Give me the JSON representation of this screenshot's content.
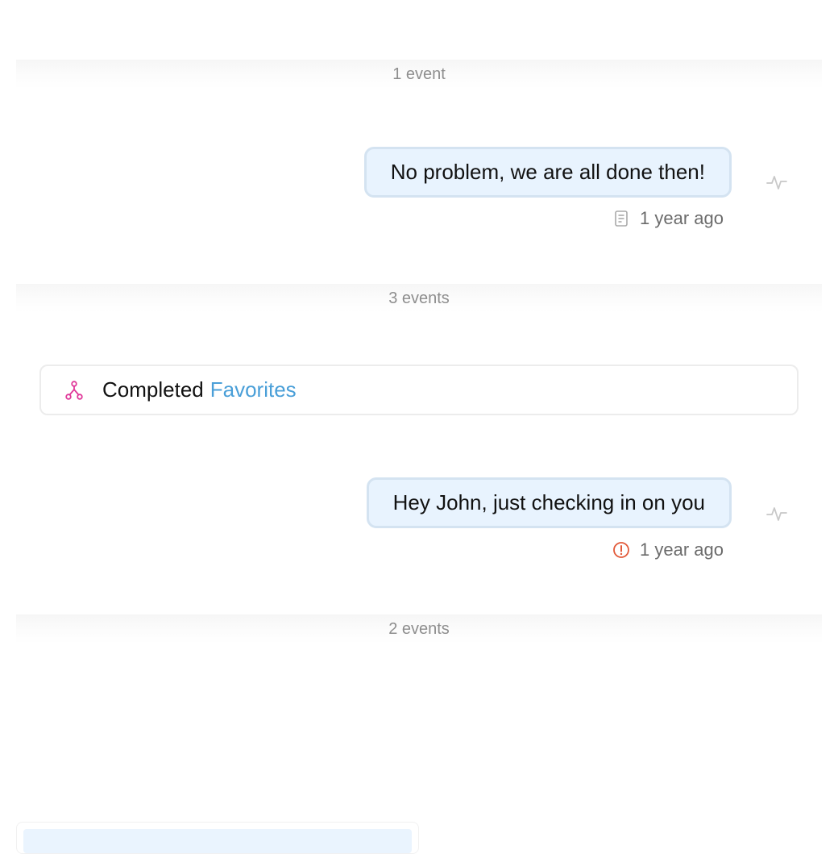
{
  "timeline": {
    "dividers": [
      {
        "label": "1 event"
      },
      {
        "label": "3 events"
      },
      {
        "label": "2 events"
      }
    ],
    "messages": [
      {
        "text": "No problem, we are all done then!",
        "time": "1 year ago",
        "status_icon": "document-icon"
      },
      {
        "text": "Hey John, just checking in on you",
        "time": "1 year ago",
        "status_icon": "error-alert-icon"
      }
    ],
    "workflow": {
      "action": "Completed",
      "link_label": "Favorites",
      "icon": "workflow-icon"
    }
  },
  "colors": {
    "bubble_bg": "#e8f3fe",
    "bubble_border": "#d4e3f1",
    "link": "#4a9fd8",
    "workflow_icon": "#e0399a",
    "error": "#e25a3a",
    "muted_text": "#8e8e8e"
  }
}
